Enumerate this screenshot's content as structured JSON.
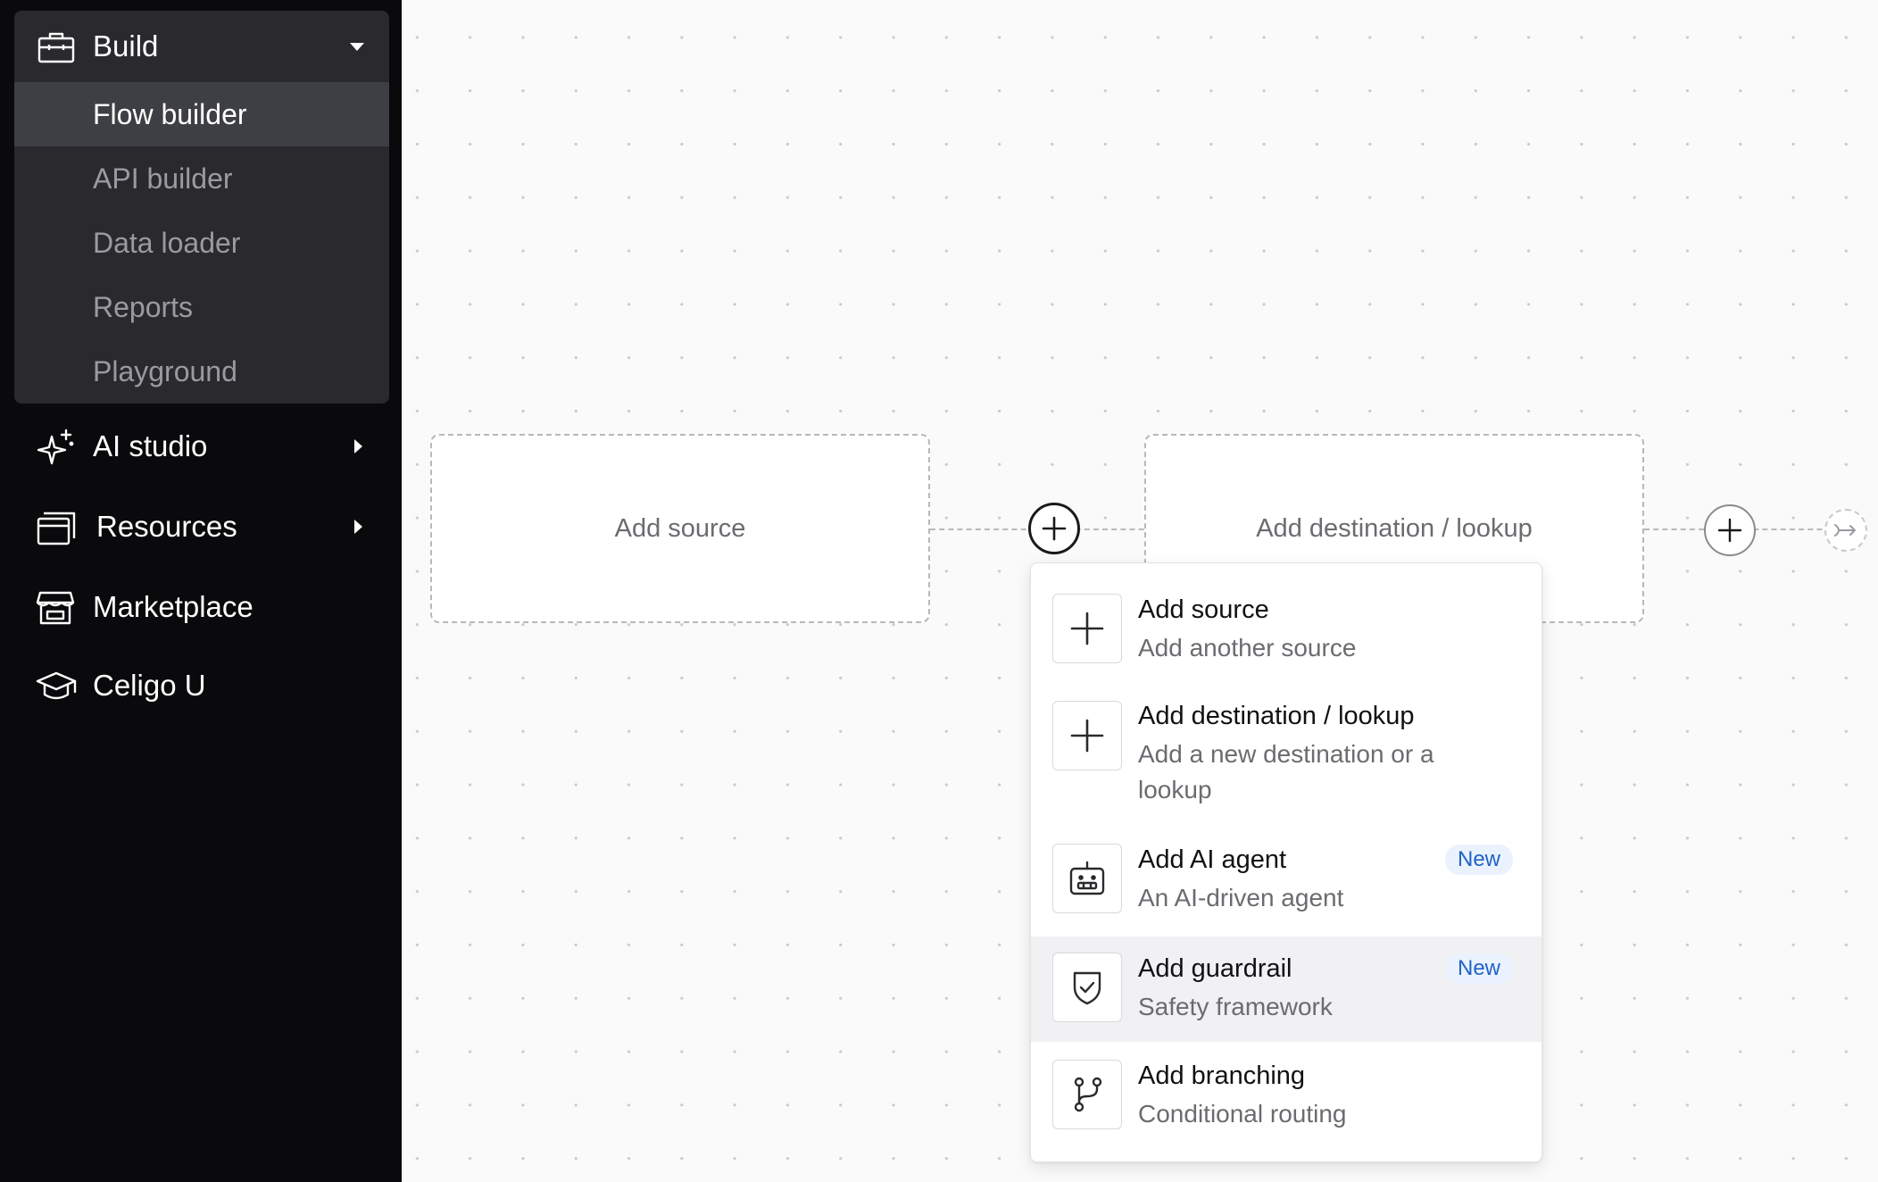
{
  "sidebar": {
    "build": {
      "label": "Build",
      "items": [
        {
          "label": "Flow builder",
          "active": true
        },
        {
          "label": "API builder"
        },
        {
          "label": "Data loader"
        },
        {
          "label": "Reports"
        },
        {
          "label": "Playground"
        }
      ]
    },
    "nav": [
      {
        "label": "AI studio",
        "icon": "sparkle-icon",
        "expandable": true
      },
      {
        "label": "Resources",
        "icon": "resources-icon",
        "expandable": true
      },
      {
        "label": "Marketplace",
        "icon": "store-icon",
        "expandable": false
      },
      {
        "label": "Celigo U",
        "icon": "graduation-cap-icon",
        "expandable": false
      }
    ]
  },
  "canvas": {
    "source_node": {
      "label": "Add source"
    },
    "destination_node": {
      "label": "Add destination / lookup"
    }
  },
  "menu": {
    "items": [
      {
        "title": "Add source",
        "description": "Add another source",
        "icon": "plus-icon"
      },
      {
        "title": "Add destination / lookup",
        "description": "Add a new destination or a lookup",
        "icon": "plus-icon"
      },
      {
        "title": "Add AI agent",
        "description": "An AI-driven agent",
        "icon": "robot-icon",
        "badge": "New"
      },
      {
        "title": "Add guardrail",
        "description": "Safety framework",
        "icon": "shield-check-icon",
        "badge": "New"
      },
      {
        "title": "Add branching",
        "description": "Conditional routing",
        "icon": "branch-icon"
      }
    ]
  },
  "colors": {
    "sidebar_bg": "#0a0a0c",
    "build_group_bg": "#2a2a2e",
    "active_item_bg": "#3e3f44",
    "badge_bg": "#eaf2fd",
    "badge_text": "#1f62c9"
  }
}
